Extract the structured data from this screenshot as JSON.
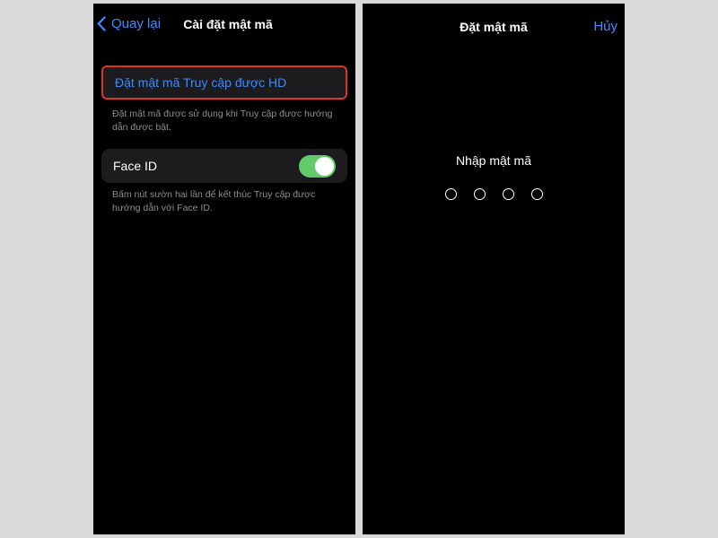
{
  "left_screen": {
    "back_label": "Quay lại",
    "title": "Cài đặt mật mã",
    "set_passcode_label": "Đặt mật mã Truy cập được HD",
    "set_passcode_footnote": "Đặt mật mã được sử dụng khi Truy cập được hướng dẫn được bật.",
    "face_id_label": "Face ID",
    "face_id_enabled": true,
    "face_id_footnote": "Bấm nút sườn hai lần để kết thúc Truy cập được hướng dẫn với Face ID."
  },
  "right_screen": {
    "title": "Đặt mật mã",
    "cancel_label": "Hủy",
    "prompt": "Nhập mật mã",
    "passcode_length": 4
  },
  "colors": {
    "accent": "#3d8bfd",
    "toggle_on": "#5fcb6a",
    "highlight_border": "#e0312b",
    "cell_background": "#1c1c1e",
    "footnote_text": "#8e8e93"
  },
  "icons": {
    "back": "chevron-left-icon"
  }
}
